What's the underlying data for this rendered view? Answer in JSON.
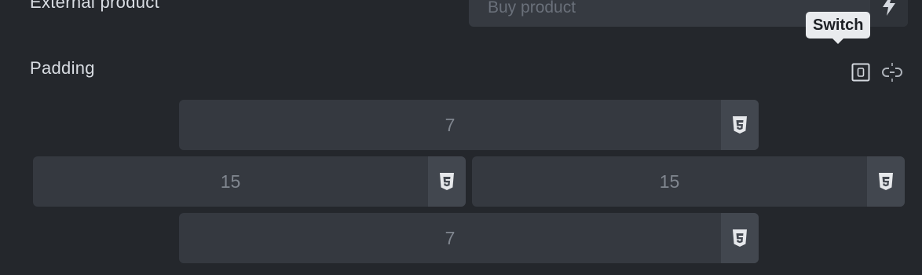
{
  "external_product": {
    "label": "External product",
    "placeholder": "Buy product",
    "action_icon": "lightning-icon"
  },
  "padding": {
    "label": "Padding",
    "tooltip": "Switch",
    "switch_icon": "switch-icon",
    "unlink_icon": "unlink-icon",
    "top": "7",
    "left": "15",
    "right": "15",
    "bottom": "7",
    "unit_icon": "css3-icon"
  },
  "colors": {
    "background": "#24272c",
    "field": "#353940",
    "unit_button": "#42474f",
    "tooltip_bg": "#e9ebee"
  }
}
